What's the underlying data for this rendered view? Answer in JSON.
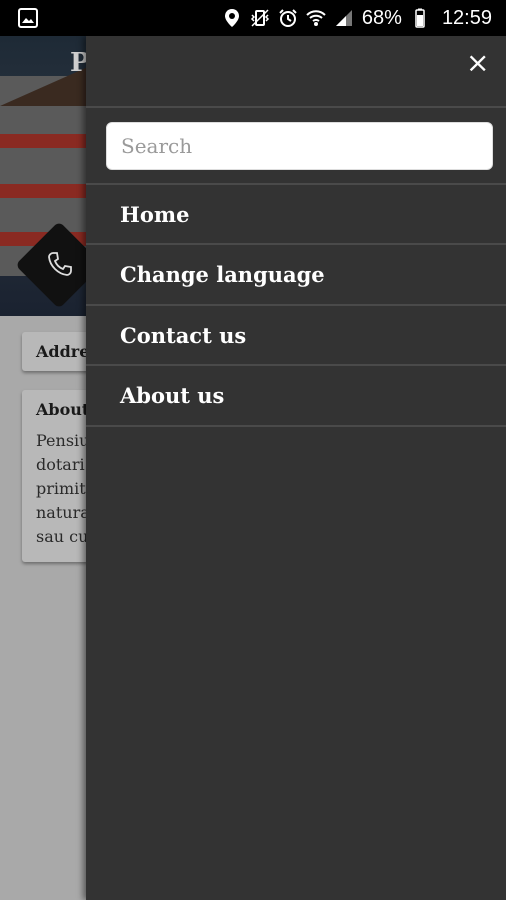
{
  "status_bar": {
    "battery_percent": "68%",
    "time": "12:59",
    "icons": [
      "gallery-icon",
      "location-icon",
      "vibrate-icon",
      "alarm-icon",
      "wifi-icon",
      "signal-icon",
      "battery-icon"
    ]
  },
  "background_app": {
    "title_fragment": "P",
    "cards": [
      {
        "heading": "Addre"
      },
      {
        "heading": "About",
        "body_lines": [
          "Pensiu",
          "dotari",
          "primit",
          "natura",
          "sau cu"
        ]
      }
    ]
  },
  "drawer": {
    "search": {
      "placeholder": "Search",
      "value": ""
    },
    "menu": [
      {
        "label": "Home"
      },
      {
        "label": "Change language"
      },
      {
        "label": "Contact us"
      },
      {
        "label": "About us"
      }
    ],
    "colors": {
      "background": "#333333",
      "separator": "#4a4a4a",
      "text": "#ffffff"
    }
  }
}
